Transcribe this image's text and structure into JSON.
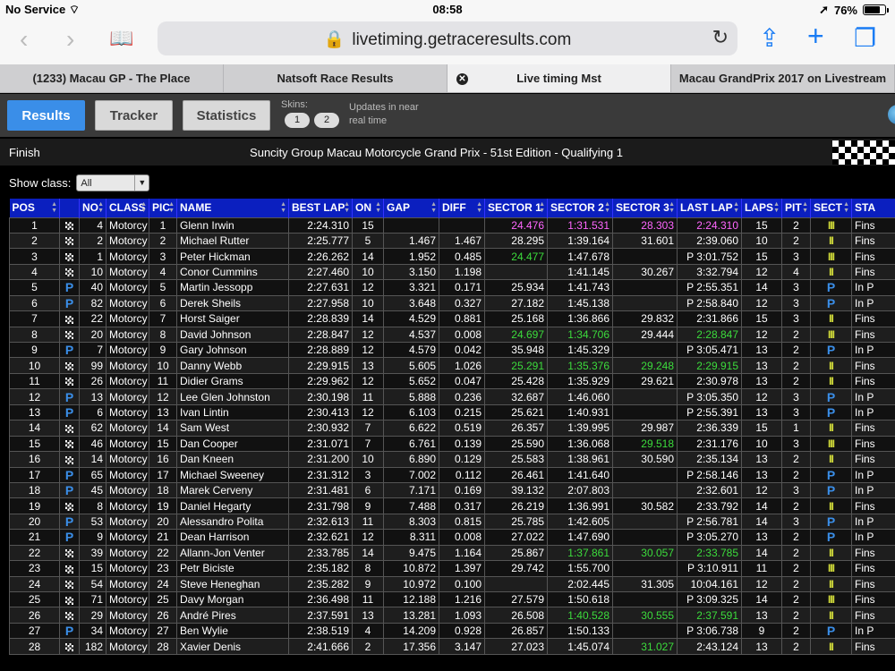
{
  "status_bar": {
    "carrier": "No Service",
    "time": "08:58",
    "battery": "76%",
    "battery_level": 0.76
  },
  "browser": {
    "url": "livetiming.getraceresults.com"
  },
  "tabs": [
    {
      "label": "(1233) Macau GP - The Place",
      "active": false
    },
    {
      "label": "Natsoft Race Results",
      "active": false
    },
    {
      "label": "Live timing Mst",
      "active": true
    },
    {
      "label": "Macau GrandPrix 2017 on Livestream",
      "active": false
    }
  ],
  "toolbar": {
    "results": "Results",
    "tracker": "Tracker",
    "statistics": "Statistics",
    "skins_label": "Skins:",
    "skin1": "1",
    "skin2": "2",
    "updates": "Updates in near real time"
  },
  "session": {
    "state": "Finish",
    "title": "Suncity Group Macau Motorcycle Grand Prix - 51st Edition - Qualifying 1"
  },
  "filter": {
    "label": "Show class:",
    "value": "All"
  },
  "table": {
    "columns": [
      "POS",
      "",
      "NO",
      "CLASS",
      "PIC",
      "NAME",
      "BEST LAP",
      "ON",
      "GAP",
      "DIFF",
      "SECTOR 1",
      "SECTOR 2",
      "SECTOR 3",
      "LAST LAP",
      "LAPS",
      "PIT",
      "SECT",
      "STA"
    ],
    "rows": [
      {
        "pos": "1",
        "flag": "chk",
        "no": "4",
        "cls": "Motorcy",
        "pic": "1",
        "name": "Glenn Irwin",
        "best": "2:24.310",
        "on": "15",
        "gap": "",
        "diff": "",
        "s1": "24.476",
        "s2": "1:31.531",
        "s3": "28.303",
        "last": "2:24.310",
        "laps": "15",
        "pit": "2",
        "sect": "III",
        "sta": "Fins",
        "hl": {
          "s1": "purple",
          "s2": "purple",
          "s3": "purple",
          "last": "purple"
        }
      },
      {
        "pos": "2",
        "flag": "chk",
        "no": "2",
        "cls": "Motorcy",
        "pic": "2",
        "name": "Michael Rutter",
        "best": "2:25.777",
        "on": "5",
        "gap": "1.467",
        "diff": "1.467",
        "s1": "28.295",
        "s2": "1:39.164",
        "s3": "31.601",
        "last": "2:39.060",
        "laps": "10",
        "pit": "2",
        "sect": "II",
        "sta": "Fins",
        "hl": {}
      },
      {
        "pos": "3",
        "flag": "chk",
        "no": "1",
        "cls": "Motorcy",
        "pic": "3",
        "name": "Peter Hickman",
        "best": "2:26.262",
        "on": "14",
        "gap": "1.952",
        "diff": "0.485",
        "s1": "24.477",
        "s2": "1:47.678",
        "s3": "",
        "last": "P 3:01.752",
        "laps": "15",
        "pit": "3",
        "sect": "III",
        "sta": "Fins",
        "hl": {
          "s1": "green"
        }
      },
      {
        "pos": "4",
        "flag": "chk",
        "no": "10",
        "cls": "Motorcy",
        "pic": "4",
        "name": "Conor Cummins",
        "best": "2:27.460",
        "on": "10",
        "gap": "3.150",
        "diff": "1.198",
        "s1": "",
        "s2": "1:41.145",
        "s3": "30.267",
        "last": "3:32.794",
        "laps": "12",
        "pit": "4",
        "sect": "II",
        "sta": "Fins",
        "hl": {}
      },
      {
        "pos": "5",
        "flag": "P",
        "no": "40",
        "cls": "Motorcy",
        "pic": "5",
        "name": "Martin Jessopp",
        "best": "2:27.631",
        "on": "12",
        "gap": "3.321",
        "diff": "0.171",
        "s1": "25.934",
        "s2": "1:41.743",
        "s3": "",
        "last": "P 2:55.351",
        "laps": "14",
        "pit": "3",
        "sect": "P",
        "sta": "In P",
        "hl": {}
      },
      {
        "pos": "6",
        "flag": "P",
        "no": "82",
        "cls": "Motorcy",
        "pic": "6",
        "name": "Derek Sheils",
        "best": "2:27.958",
        "on": "10",
        "gap": "3.648",
        "diff": "0.327",
        "s1": "27.182",
        "s2": "1:45.138",
        "s3": "",
        "last": "P 2:58.840",
        "laps": "12",
        "pit": "3",
        "sect": "P",
        "sta": "In P",
        "hl": {}
      },
      {
        "pos": "7",
        "flag": "chk",
        "no": "22",
        "cls": "Motorcy",
        "pic": "7",
        "name": "Horst Saiger",
        "best": "2:28.839",
        "on": "14",
        "gap": "4.529",
        "diff": "0.881",
        "s1": "25.168",
        "s2": "1:36.866",
        "s3": "29.832",
        "last": "2:31.866",
        "laps": "15",
        "pit": "3",
        "sect": "II",
        "sta": "Fins",
        "hl": {}
      },
      {
        "pos": "8",
        "flag": "chk",
        "no": "20",
        "cls": "Motorcy",
        "pic": "8",
        "name": "David Johnson",
        "best": "2:28.847",
        "on": "12",
        "gap": "4.537",
        "diff": "0.008",
        "s1": "24.697",
        "s2": "1:34.706",
        "s3": "29.444",
        "last": "2:28.847",
        "laps": "12",
        "pit": "2",
        "sect": "III",
        "sta": "Fins",
        "hl": {
          "s1": "green",
          "s2": "green",
          "last": "green"
        }
      },
      {
        "pos": "9",
        "flag": "P",
        "no": "7",
        "cls": "Motorcy",
        "pic": "9",
        "name": "Gary Johnson",
        "best": "2:28.889",
        "on": "12",
        "gap": "4.579",
        "diff": "0.042",
        "s1": "35.948",
        "s2": "1:45.329",
        "s3": "",
        "last": "P 3:05.471",
        "laps": "13",
        "pit": "2",
        "sect": "P",
        "sta": "In P",
        "hl": {}
      },
      {
        "pos": "10",
        "flag": "chk",
        "no": "99",
        "cls": "Motorcy",
        "pic": "10",
        "name": "Danny Webb",
        "best": "2:29.915",
        "on": "13",
        "gap": "5.605",
        "diff": "1.026",
        "s1": "25.291",
        "s2": "1:35.376",
        "s3": "29.248",
        "last": "2:29.915",
        "laps": "13",
        "pit": "2",
        "sect": "II",
        "sta": "Fins",
        "hl": {
          "s1": "green",
          "s2": "green",
          "s3": "green",
          "last": "green"
        }
      },
      {
        "pos": "11",
        "flag": "chk",
        "no": "26",
        "cls": "Motorcy",
        "pic": "11",
        "name": "Didier Grams",
        "best": "2:29.962",
        "on": "12",
        "gap": "5.652",
        "diff": "0.047",
        "s1": "25.428",
        "s2": "1:35.929",
        "s3": "29.621",
        "last": "2:30.978",
        "laps": "13",
        "pit": "2",
        "sect": "II",
        "sta": "Fins",
        "hl": {}
      },
      {
        "pos": "12",
        "flag": "P",
        "no": "13",
        "cls": "Motorcy",
        "pic": "12",
        "name": "Lee Glen Johnston",
        "best": "2:30.198",
        "on": "11",
        "gap": "5.888",
        "diff": "0.236",
        "s1": "32.687",
        "s2": "1:46.060",
        "s3": "",
        "last": "P 3:05.350",
        "laps": "12",
        "pit": "3",
        "sect": "P",
        "sta": "In P",
        "hl": {}
      },
      {
        "pos": "13",
        "flag": "P",
        "no": "6",
        "cls": "Motorcy",
        "pic": "13",
        "name": "Ivan Lintin",
        "best": "2:30.413",
        "on": "12",
        "gap": "6.103",
        "diff": "0.215",
        "s1": "25.621",
        "s2": "1:40.931",
        "s3": "",
        "last": "P 2:55.391",
        "laps": "13",
        "pit": "3",
        "sect": "P",
        "sta": "In P",
        "hl": {}
      },
      {
        "pos": "14",
        "flag": "chk",
        "no": "62",
        "cls": "Motorcy",
        "pic": "14",
        "name": "Sam West",
        "best": "2:30.932",
        "on": "7",
        "gap": "6.622",
        "diff": "0.519",
        "s1": "26.357",
        "s2": "1:39.995",
        "s3": "29.987",
        "last": "2:36.339",
        "laps": "15",
        "pit": "1",
        "sect": "II",
        "sta": "Fins",
        "hl": {}
      },
      {
        "pos": "15",
        "flag": "chk",
        "no": "46",
        "cls": "Motorcy",
        "pic": "15",
        "name": "Dan Cooper",
        "best": "2:31.071",
        "on": "7",
        "gap": "6.761",
        "diff": "0.139",
        "s1": "25.590",
        "s2": "1:36.068",
        "s3": "29.518",
        "last": "2:31.176",
        "laps": "10",
        "pit": "3",
        "sect": "III",
        "sta": "Fins",
        "hl": {
          "s3": "green"
        }
      },
      {
        "pos": "16",
        "flag": "chk",
        "no": "14",
        "cls": "Motorcy",
        "pic": "16",
        "name": "Dan Kneen",
        "best": "2:31.200",
        "on": "10",
        "gap": "6.890",
        "diff": "0.129",
        "s1": "25.583",
        "s2": "1:38.961",
        "s3": "30.590",
        "last": "2:35.134",
        "laps": "13",
        "pit": "2",
        "sect": "II",
        "sta": "Fins",
        "hl": {}
      },
      {
        "pos": "17",
        "flag": "P",
        "no": "65",
        "cls": "Motorcy",
        "pic": "17",
        "name": "Michael Sweeney",
        "best": "2:31.312",
        "on": "3",
        "gap": "7.002",
        "diff": "0.112",
        "s1": "26.461",
        "s2": "1:41.640",
        "s3": "",
        "last": "P 2:58.146",
        "laps": "13",
        "pit": "2",
        "sect": "P",
        "sta": "In P",
        "hl": {}
      },
      {
        "pos": "18",
        "flag": "P",
        "no": "45",
        "cls": "Motorcy",
        "pic": "18",
        "name": "Marek Cerveny",
        "best": "2:31.481",
        "on": "6",
        "gap": "7.171",
        "diff": "0.169",
        "s1": "39.132",
        "s2": "2:07.803",
        "s3": "",
        "last": "2:32.601",
        "laps": "12",
        "pit": "3",
        "sect": "P",
        "sta": "In P",
        "hl": {}
      },
      {
        "pos": "19",
        "flag": "chk",
        "no": "8",
        "cls": "Motorcy",
        "pic": "19",
        "name": "Daniel Hegarty",
        "best": "2:31.798",
        "on": "9",
        "gap": "7.488",
        "diff": "0.317",
        "s1": "26.219",
        "s2": "1:36.991",
        "s3": "30.582",
        "last": "2:33.792",
        "laps": "14",
        "pit": "2",
        "sect": "II",
        "sta": "Fins",
        "hl": {}
      },
      {
        "pos": "20",
        "flag": "P",
        "no": "53",
        "cls": "Motorcy",
        "pic": "20",
        "name": "Alessandro Polita",
        "best": "2:32.613",
        "on": "11",
        "gap": "8.303",
        "diff": "0.815",
        "s1": "25.785",
        "s2": "1:42.605",
        "s3": "",
        "last": "P 2:56.781",
        "laps": "14",
        "pit": "3",
        "sect": "P",
        "sta": "In P",
        "hl": {}
      },
      {
        "pos": "21",
        "flag": "P",
        "no": "9",
        "cls": "Motorcy",
        "pic": "21",
        "name": "Dean Harrison",
        "best": "2:32.621",
        "on": "12",
        "gap": "8.311",
        "diff": "0.008",
        "s1": "27.022",
        "s2": "1:47.690",
        "s3": "",
        "last": "P 3:05.270",
        "laps": "13",
        "pit": "2",
        "sect": "P",
        "sta": "In P",
        "hl": {}
      },
      {
        "pos": "22",
        "flag": "chk",
        "no": "39",
        "cls": "Motorcy",
        "pic": "22",
        "name": "Allann-Jon Venter",
        "best": "2:33.785",
        "on": "14",
        "gap": "9.475",
        "diff": "1.164",
        "s1": "25.867",
        "s2": "1:37.861",
        "s3": "30.057",
        "last": "2:33.785",
        "laps": "14",
        "pit": "2",
        "sect": "II",
        "sta": "Fins",
        "hl": {
          "s2": "green",
          "s3": "green",
          "last": "green"
        }
      },
      {
        "pos": "23",
        "flag": "chk",
        "no": "15",
        "cls": "Motorcy",
        "pic": "23",
        "name": "Petr Biciste",
        "best": "2:35.182",
        "on": "8",
        "gap": "10.872",
        "diff": "1.397",
        "s1": "29.742",
        "s2": "1:55.700",
        "s3": "",
        "last": "P 3:10.911",
        "laps": "11",
        "pit": "2",
        "sect": "III",
        "sta": "Fins",
        "hl": {}
      },
      {
        "pos": "24",
        "flag": "chk",
        "no": "54",
        "cls": "Motorcy",
        "pic": "24",
        "name": "Steve Heneghan",
        "best": "2:35.282",
        "on": "9",
        "gap": "10.972",
        "diff": "0.100",
        "s1": "",
        "s2": "2:02.445",
        "s3": "31.305",
        "last": "10:04.161",
        "laps": "12",
        "pit": "2",
        "sect": "II",
        "sta": "Fins",
        "hl": {}
      },
      {
        "pos": "25",
        "flag": "chk",
        "no": "71",
        "cls": "Motorcy",
        "pic": "25",
        "name": "Davy Morgan",
        "best": "2:36.498",
        "on": "11",
        "gap": "12.188",
        "diff": "1.216",
        "s1": "27.579",
        "s2": "1:50.618",
        "s3": "",
        "last": "P 3:09.325",
        "laps": "14",
        "pit": "2",
        "sect": "III",
        "sta": "Fins",
        "hl": {}
      },
      {
        "pos": "26",
        "flag": "chk",
        "no": "29",
        "cls": "Motorcy",
        "pic": "26",
        "name": "André Pires",
        "best": "2:37.591",
        "on": "13",
        "gap": "13.281",
        "diff": "1.093",
        "s1": "26.508",
        "s2": "1:40.528",
        "s3": "30.555",
        "last": "2:37.591",
        "laps": "13",
        "pit": "2",
        "sect": "II",
        "sta": "Fins",
        "hl": {
          "s2": "green",
          "s3": "green",
          "last": "green"
        }
      },
      {
        "pos": "27",
        "flag": "P",
        "no": "34",
        "cls": "Motorcy",
        "pic": "27",
        "name": "Ben Wylie",
        "best": "2:38.519",
        "on": "4",
        "gap": "14.209",
        "diff": "0.928",
        "s1": "26.857",
        "s2": "1:50.133",
        "s3": "",
        "last": "P 3:06.738",
        "laps": "9",
        "pit": "2",
        "sect": "P",
        "sta": "In P",
        "hl": {}
      },
      {
        "pos": "28",
        "flag": "chk",
        "no": "182",
        "cls": "Motorcy",
        "pic": "28",
        "name": "Xavier Denis",
        "best": "2:41.666",
        "on": "2",
        "gap": "17.356",
        "diff": "3.147",
        "s1": "27.023",
        "s2": "1:45.074",
        "s3": "31.027",
        "last": "2:43.124",
        "laps": "13",
        "pit": "2",
        "sect": "II",
        "sta": "Fins",
        "hl": {
          "s3": "green"
        }
      }
    ]
  }
}
